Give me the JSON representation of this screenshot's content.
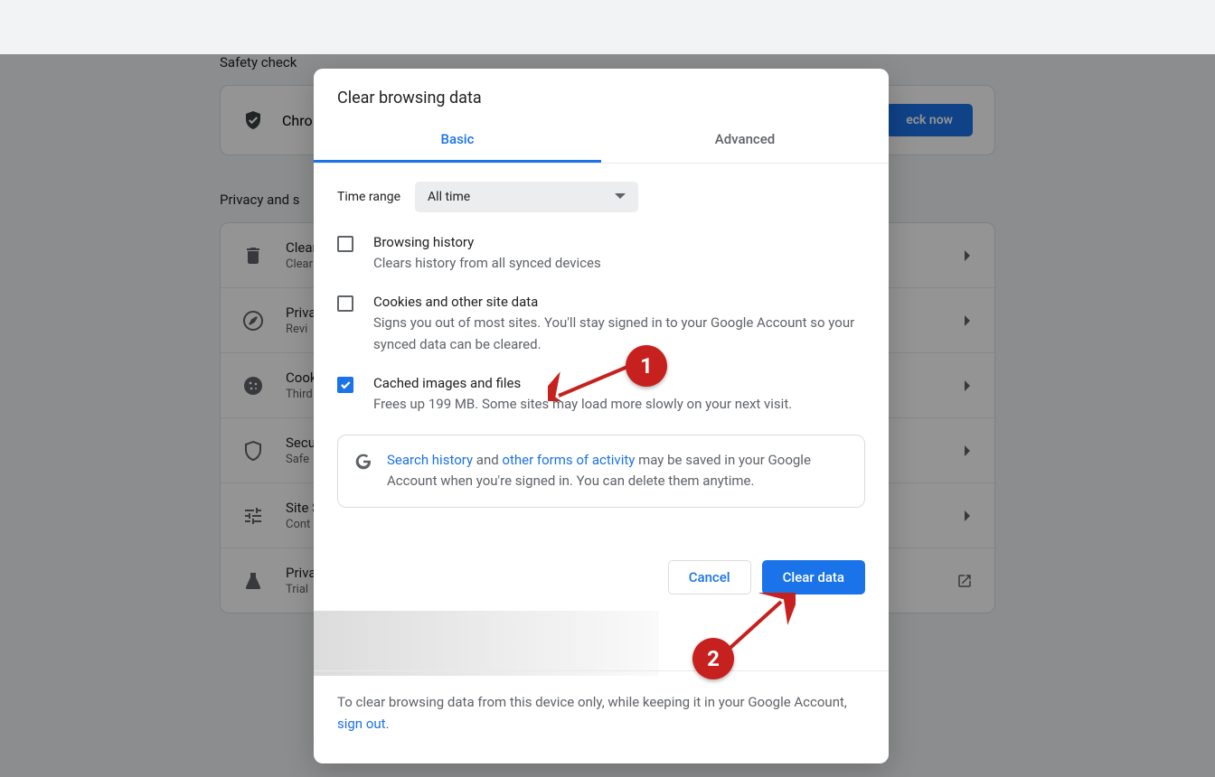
{
  "background": {
    "safetyCheckLabel": "Safety check",
    "safetyText": "Chro",
    "checkNowLabel": "eck now",
    "privacyLabel": "Privacy and s",
    "rows": [
      {
        "title": "Clear",
        "sub": "Clear"
      },
      {
        "title": "Priva",
        "sub": "Revi"
      },
      {
        "title": "Cook",
        "sub": "Third"
      },
      {
        "title": "Secu",
        "sub": "Safe"
      },
      {
        "title": "Site S",
        "sub": "Cont"
      },
      {
        "title": "Priva",
        "sub": "Trial"
      }
    ]
  },
  "modal": {
    "title": "Clear browsing data",
    "tabs": {
      "basic": "Basic",
      "advanced": "Advanced"
    },
    "timeRange": {
      "label": "Time range",
      "value": "All time"
    },
    "items": [
      {
        "title": "Browsing history",
        "sub": "Clears history from all synced devices",
        "checked": false
      },
      {
        "title": "Cookies and other site data",
        "sub": "Signs you out of most sites. You'll stay signed in to your Google Account so your synced data can be cleared.",
        "checked": false
      },
      {
        "title": "Cached images and files",
        "sub": "Frees up 199 MB. Some sites may load more slowly on your next visit.",
        "checked": true
      }
    ],
    "infoBox": {
      "link1": "Search history",
      "conj": " and ",
      "link2": "other forms of activity",
      "rest": " may be saved in your Google Account when you're signed in. You can delete them anytime."
    },
    "cancelLabel": "Cancel",
    "clearLabel": "Clear data",
    "footer": {
      "text": "To clear browsing data from this device only, while keeping it in your Google Account, ",
      "link": "sign out",
      "dot": "."
    },
    "annot1": "1",
    "annot2": "2"
  }
}
